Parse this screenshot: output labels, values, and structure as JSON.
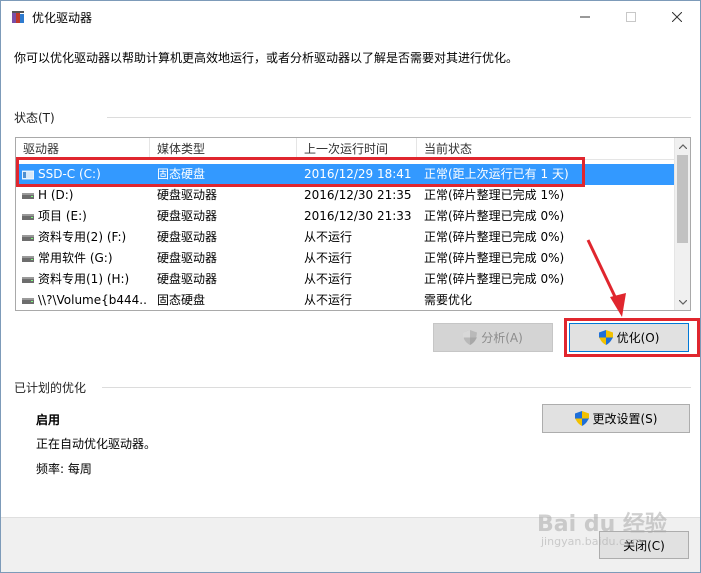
{
  "window": {
    "title": "优化驱动器",
    "description": "你可以优化驱动器以帮助计算机更高效地运行，或者分析驱动器以了解是否需要对其进行优化。"
  },
  "status_group": {
    "label": "状态(T)",
    "columns": [
      "驱动器",
      "媒体类型",
      "上一次运行时间",
      "当前状态"
    ],
    "rows": [
      {
        "drive": "SSD-C (C:)",
        "media": "固态硬盘",
        "last_run": "2016/12/29 18:41",
        "status": "正常(距上次运行已有 1 天)",
        "icon": "ssd-drive-icon"
      },
      {
        "drive": "H (D:)",
        "media": "硬盘驱动器",
        "last_run": "2016/12/30 21:35",
        "status": "正常(碎片整理已完成 1%)",
        "icon": "hdd-drive-icon"
      },
      {
        "drive": "项目 (E:)",
        "media": "硬盘驱动器",
        "last_run": "2016/12/30 21:33",
        "status": "正常(碎片整理已完成 0%)",
        "icon": "hdd-drive-icon"
      },
      {
        "drive": "资料专用(2) (F:)",
        "media": "硬盘驱动器",
        "last_run": "从不运行",
        "status": "正常(碎片整理已完成 0%)",
        "icon": "hdd-drive-icon"
      },
      {
        "drive": "常用软件 (G:)",
        "media": "硬盘驱动器",
        "last_run": "从不运行",
        "status": "正常(碎片整理已完成 0%)",
        "icon": "hdd-drive-icon"
      },
      {
        "drive": "资料专用(1) (H:)",
        "media": "硬盘驱动器",
        "last_run": "从不运行",
        "status": "正常(碎片整理已完成 0%)",
        "icon": "hdd-drive-icon"
      },
      {
        "drive": "\\\\?\\Volume{b444...",
        "media": "固态硬盘",
        "last_run": "从不运行",
        "status": "需要优化",
        "icon": "hdd-drive-icon"
      }
    ],
    "selected_index": 0
  },
  "buttons": {
    "analyze": "分析(A)",
    "optimize": "优化(O)",
    "change_settings": "更改设置(S)",
    "close": "关闭(C)"
  },
  "scheduled": {
    "label": "已计划的优化",
    "state": "启用",
    "detail": "正在自动优化驱动器。",
    "frequency": "频率: 每周"
  },
  "watermark": {
    "brand": "Bai du 经验",
    "url": "jingyan.baidu.com"
  },
  "colors": {
    "selection": "#3399ff",
    "annotation_red": "#e0262e"
  }
}
